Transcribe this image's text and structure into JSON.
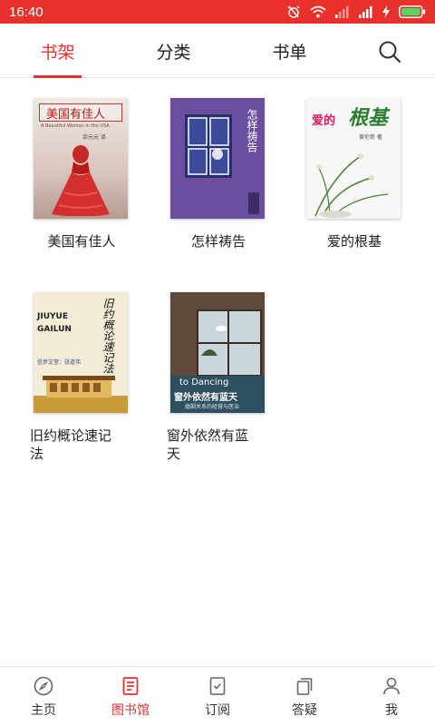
{
  "status_bar": {
    "time": "16:40"
  },
  "tabs": [
    {
      "label": "书架",
      "active": true
    },
    {
      "label": "分类",
      "active": false
    },
    {
      "label": "书单",
      "active": false
    }
  ],
  "search": {
    "icon": "search-icon"
  },
  "books": [
    {
      "title": "美国有佳人",
      "cover_title": "美国有佳人",
      "cover_subtitle": "A Beautiful Woman in the USA",
      "cover_author": "余元元  译",
      "color": "#c8b3a9"
    },
    {
      "title": "怎样祷告",
      "cover_title": "怎样祷告",
      "color": "#6a4d9e"
    },
    {
      "title": "爱的根基",
      "cover_title_a": "爱的",
      "cover_title_b": "根基",
      "cover_author": "黄伦新  著",
      "color": "#f5f5f5"
    },
    {
      "title": "旧约概论速记法",
      "cover_title": "旧约概论速记法",
      "cover_latin_a": "JIUYUE",
      "cover_latin_b": "GAILUN",
      "cover_author": "信步文堂：张道伟",
      "color": "#f2ead2"
    },
    {
      "title": "窗外依然有蓝天",
      "cover_title": "窗外依然有蓝天",
      "cover_en": "to Dancing",
      "cover_subtitle": "婚姻关系的经营与医治",
      "color": "#6a5a46"
    }
  ],
  "bottom_nav": [
    {
      "label": "主页",
      "icon": "compass-icon",
      "active": false
    },
    {
      "label": "图书馆",
      "icon": "library-icon",
      "active": true
    },
    {
      "label": "订阅",
      "icon": "subscribe-icon",
      "active": false
    },
    {
      "label": "答疑",
      "icon": "qa-icon",
      "active": false
    },
    {
      "label": "我",
      "icon": "person-icon",
      "active": false
    }
  ],
  "colors": {
    "accent": "#e8312b",
    "text": "#222222",
    "divider": "#e6e6e6"
  }
}
